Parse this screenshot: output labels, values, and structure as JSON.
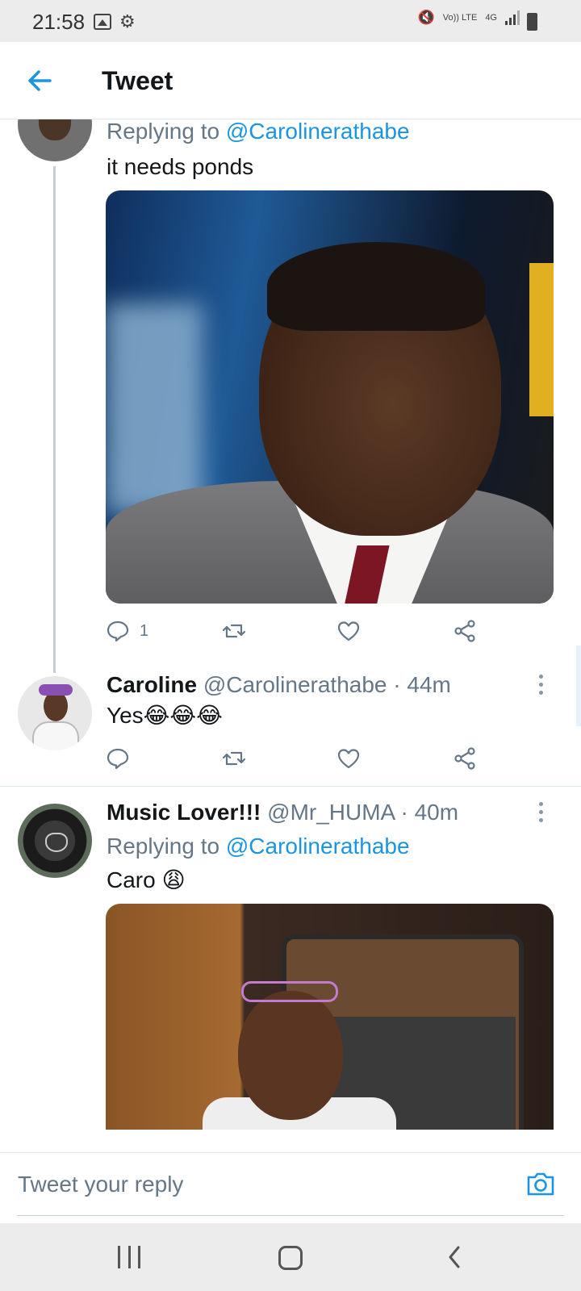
{
  "status_bar": {
    "time": "21:58",
    "lte_label": "Vo)) LTE",
    "net_label": "4G",
    "icons": [
      "gallery-icon",
      "gear-icon",
      "mute-icon",
      "signal-icon",
      "battery-icon"
    ]
  },
  "header": {
    "title": "Tweet"
  },
  "tweets": [
    {
      "replying_prefix": "Replying to ",
      "replying_handle": "@Carolinerathabe",
      "text": "it needs ponds",
      "reply_count": "1"
    },
    {
      "name": "Caroline",
      "handle": "@Carolinerathabe",
      "time": " · 44m",
      "text": "Yes😂😂😂"
    },
    {
      "name": "Music Lover!!!",
      "handle": "@Mr_HUMA",
      "time": " · 40m",
      "replying_prefix": "Replying to ",
      "replying_handle": "@Carolinerathabe",
      "text": "Caro 😩"
    }
  ],
  "reply_bar": {
    "placeholder": "Tweet your reply"
  },
  "colors": {
    "accent": "#1b95e0",
    "muted": "#657786",
    "text": "#14171a"
  }
}
